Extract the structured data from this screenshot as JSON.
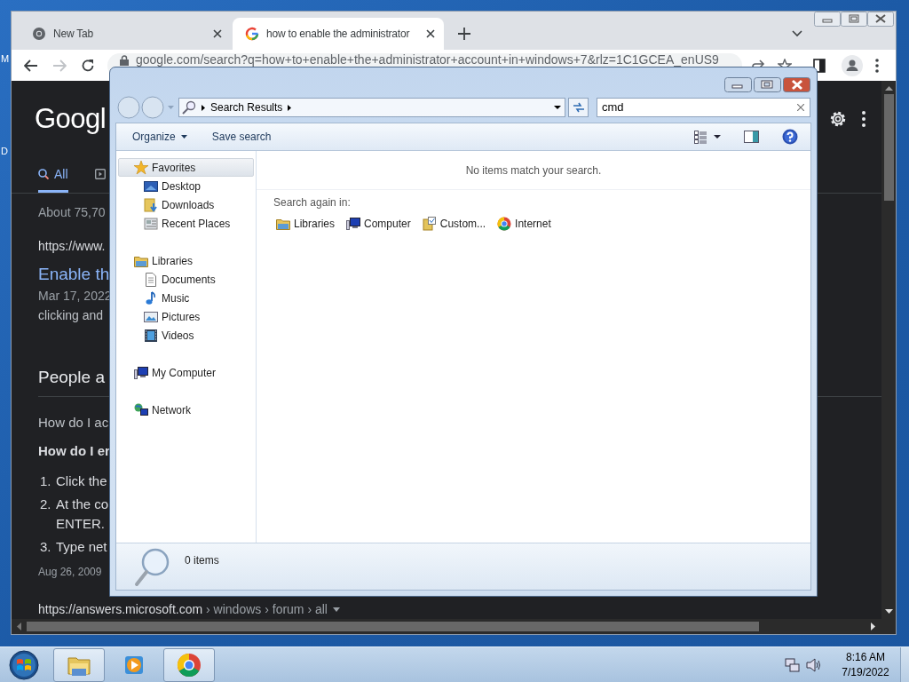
{
  "desktop": {
    "icon_labels": [
      "M",
      "D"
    ]
  },
  "browser": {
    "tabs": [
      {
        "kind": "newtab",
        "title": "New Tab",
        "selected": false
      },
      {
        "kind": "google",
        "title": "how to enable the administrator",
        "selected": true
      }
    ],
    "address": "google.com/search?q=how+to+enable+the+administrator+account+in+windows+7&rlz=1C1GCEA_enUS9",
    "page": {
      "logo": "Googl",
      "search_tabs": [
        {
          "label": "All",
          "selected": true
        }
      ],
      "results": [
        {
          "kind": "stats",
          "text": "About 75,70"
        },
        {
          "kind": "url",
          "text": "https://www."
        },
        {
          "kind": "title",
          "text": "Enable th"
        },
        {
          "kind": "date",
          "text": "Mar 17, 2022"
        },
        {
          "kind": "snippet",
          "text": "clicking and"
        },
        {
          "kind": "heading",
          "text": "People a"
        },
        {
          "kind": "question",
          "text": "How do I ac"
        },
        {
          "kind": "answer-title",
          "text": "How do I er"
        },
        {
          "kind": "step",
          "number": "1.",
          "lines": [
            "Click the"
          ]
        },
        {
          "kind": "step",
          "number": "2.",
          "lines": [
            "At the co",
            "ENTER."
          ]
        },
        {
          "kind": "step",
          "number": "3.",
          "lines": [
            "Type net"
          ]
        },
        {
          "kind": "meta-date",
          "text": "Aug 26, 2009"
        },
        {
          "kind": "cite",
          "domain": "https://answers.microsoft.com",
          "path": " › windows › forum › all"
        }
      ]
    }
  },
  "explorer": {
    "breadcrumb": "Search Results",
    "search_value": "cmd",
    "commands": [
      {
        "label": "Organize",
        "menu": true
      },
      {
        "label": "Save search",
        "menu": false
      }
    ],
    "nav": [
      {
        "kind": "favorites",
        "label": "Favorites",
        "selected": true,
        "children": [
          {
            "kind": "desktop",
            "label": "Desktop",
            "selected": false
          },
          {
            "kind": "downloads",
            "label": "Downloads",
            "selected": false
          },
          {
            "kind": "recent",
            "label": "Recent Places",
            "selected": false
          }
        ]
      },
      {
        "kind": "libraries",
        "label": "Libraries",
        "selected": false,
        "children": [
          {
            "kind": "documents",
            "label": "Documents",
            "selected": false
          },
          {
            "kind": "music",
            "label": "Music",
            "selected": false
          },
          {
            "kind": "pictures",
            "label": "Pictures",
            "selected": false
          },
          {
            "kind": "videos",
            "label": "Videos",
            "selected": false
          }
        ]
      },
      {
        "kind": "computer",
        "label": "My Computer",
        "selected": false
      },
      {
        "kind": "network",
        "label": "Network",
        "selected": false
      }
    ],
    "message": "No items match your search.",
    "search_again_label": "Search again in:",
    "search_again": [
      {
        "kind": "libraries",
        "label": "Libraries"
      },
      {
        "kind": "computer",
        "label": "Computer"
      },
      {
        "kind": "custom",
        "label": "Custom..."
      },
      {
        "kind": "internet",
        "label": "Internet"
      }
    ],
    "status": "0 items"
  },
  "taskbar": {
    "buttons": [
      {
        "kind": "explorer",
        "open": true
      },
      {
        "kind": "media",
        "open": false
      },
      {
        "kind": "chrome",
        "open": true
      }
    ],
    "time": "8:16 AM",
    "date": "7/19/2022"
  }
}
